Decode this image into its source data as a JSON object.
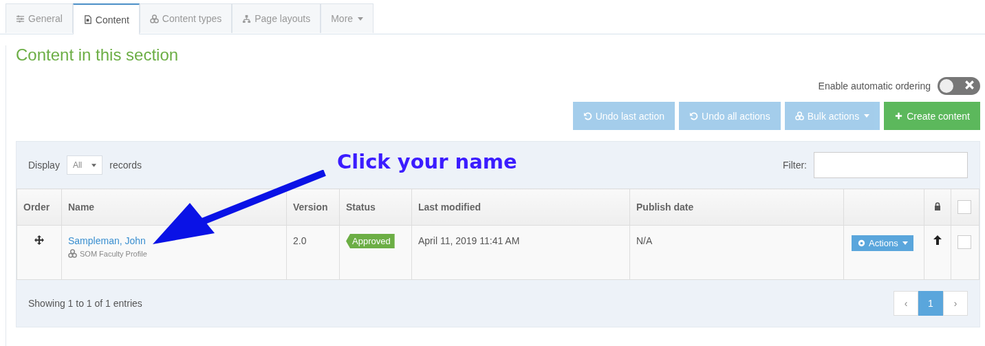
{
  "tabs": [
    {
      "label": "General",
      "kind": "plain",
      "selected": false
    },
    {
      "label": "Content",
      "kind": "plain",
      "selected": true
    },
    {
      "label": "Content types",
      "kind": "plain",
      "selected": false
    },
    {
      "label": "Page layouts",
      "kind": "plain",
      "selected": false
    },
    {
      "label": "More",
      "kind": "dropdown",
      "selected": false
    }
  ],
  "section_title": "Content in this section",
  "auto_ordering": {
    "label": "Enable automatic ordering",
    "on": false
  },
  "buttons": [
    {
      "label": "Undo last action",
      "kind": "info",
      "disabled": true
    },
    {
      "label": "Undo all actions",
      "kind": "info",
      "disabled": true
    },
    {
      "label": "Bulk actions",
      "kind": "dropdown",
      "disabled": true
    },
    {
      "label": "Create content",
      "kind": "success",
      "disabled": false
    }
  ],
  "display": {
    "label_before": "Display",
    "value": "All",
    "label_after": "records"
  },
  "filter": {
    "label": "Filter:"
  },
  "annotation": {
    "text": "Click your name"
  },
  "table": {
    "columns": [
      "Order",
      "Name",
      "Version",
      "Status",
      "Last modified",
      "Publish date"
    ],
    "select_all_checked": false,
    "rows": [
      {
        "name": "Sampleman, John",
        "type": "SOM Faculty Profile",
        "version": "2.0",
        "status": "Approved",
        "last_modified": "April 11, 2019 11:41 AM",
        "publish_date": "N/A",
        "actions": "Actions",
        "checked": false
      }
    ]
  },
  "footer": {
    "info": "Showing 1 to 1 of 1 entries"
  },
  "pagination": [
    {
      "label": "‹",
      "selected": false
    },
    {
      "label": "1",
      "selected": true
    },
    {
      "label": "›",
      "selected": false
    }
  ]
}
